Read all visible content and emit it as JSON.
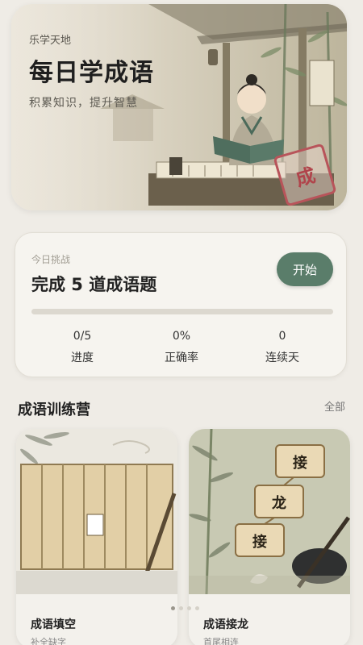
{
  "hero": {
    "eyebrow": "乐学天地",
    "title": "每日学成语",
    "subtitle": "积累知识，提升智慧",
    "seal_char": "成"
  },
  "challenge": {
    "eyebrow": "今日挑战",
    "title": "完成 5 道成语题",
    "start_label": "开始",
    "progress_fraction": 0,
    "stats": [
      {
        "value": "0/5",
        "label": "进度"
      },
      {
        "value": "0%",
        "label": "正确率"
      },
      {
        "value": "0",
        "label": "连续天"
      }
    ]
  },
  "section": {
    "title": "成语训练营",
    "link": "全部"
  },
  "cards": [
    {
      "title": "成语填空",
      "subtitle": "补全缺字",
      "icon": "bamboo-scroll-icon"
    },
    {
      "title": "成语接龙",
      "subtitle": "首尾相连",
      "icon": "hanging-scrolls-icon",
      "chars": [
        "接",
        "龙",
        "接"
      ]
    }
  ],
  "pager": {
    "count": 4,
    "active": 0
  },
  "colors": {
    "accent": "#5a7d6a",
    "seal": "#b0444b",
    "background": "#efece6"
  }
}
